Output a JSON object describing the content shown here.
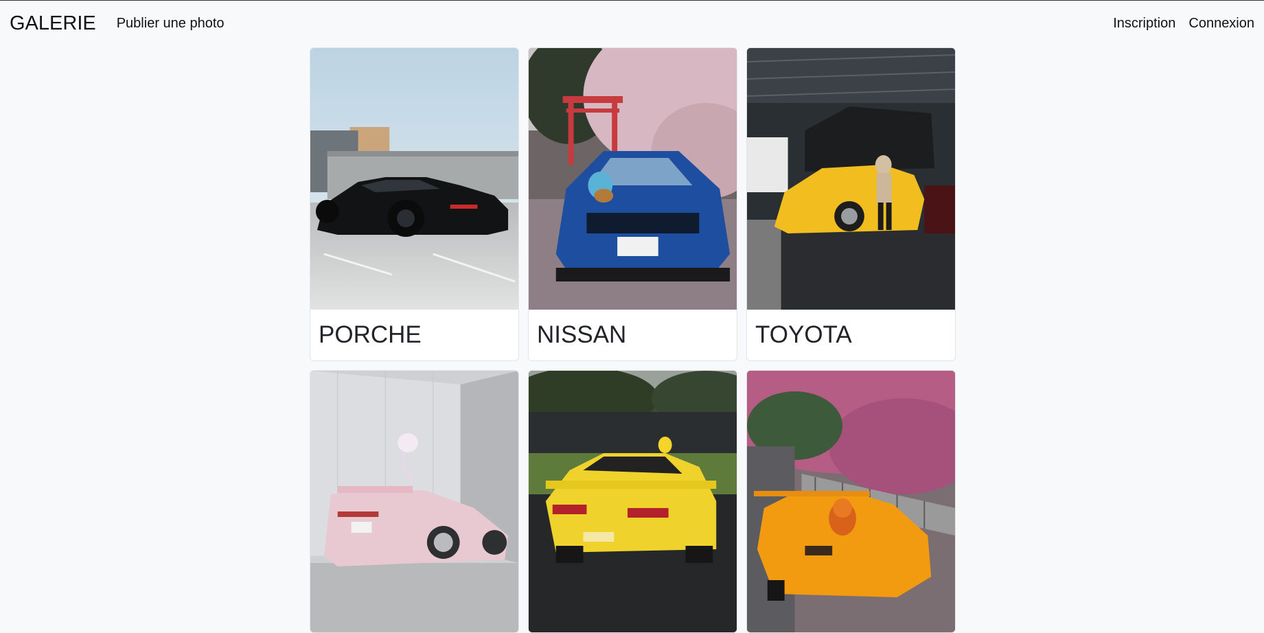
{
  "navbar": {
    "brand": "GALERIE",
    "publish_label": "Publier une photo",
    "register_label": "Inscription",
    "login_label": "Connexion"
  },
  "gallery": {
    "cards": [
      {
        "title": "PORCHE",
        "image": "black porsche parked on concrete"
      },
      {
        "title": "NISSAN",
        "image": "blue nissan skyline under cherry blossoms"
      },
      {
        "title": "TOYOTA",
        "image": "yellow toyota supra at car show"
      },
      {
        "title": "",
        "image": "pink toyota supra"
      },
      {
        "title": "",
        "image": "yellow nissan silvia"
      },
      {
        "title": "",
        "image": "orange mazda rx-7 under pink blossoms"
      }
    ]
  },
  "colors": {
    "page_bg": "#f8f9fa",
    "card_bg": "#ffffff",
    "text": "#212529"
  }
}
